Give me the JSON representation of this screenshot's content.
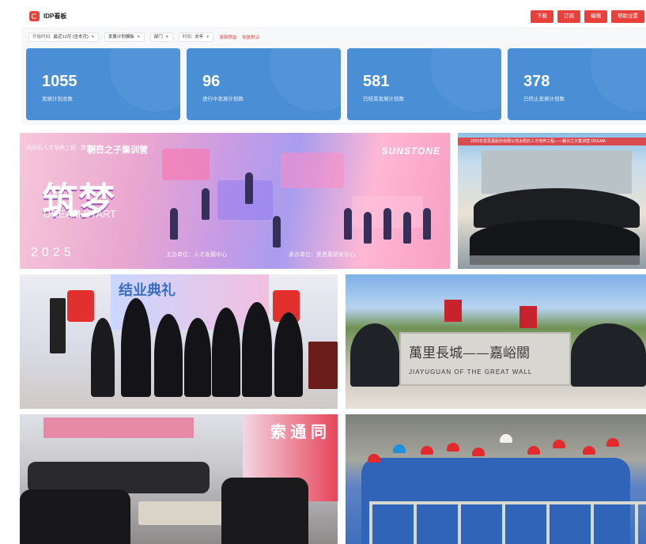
{
  "app": {
    "title": "IDP看板",
    "logo_icon": "app-logo-icon",
    "accent": "#e8403a",
    "card_color": "#4a8fd6"
  },
  "actions": [
    "下载",
    "订阅",
    "编辑",
    "帮助设置"
  ],
  "filters": [
    {
      "label": "开始时间:",
      "value": "最近12月 (含本月)"
    },
    {
      "label": "",
      "value": "发展计划模板"
    },
    {
      "label": "",
      "value": "部门"
    },
    {
      "label": "时间:",
      "value": "去年"
    }
  ],
  "filter_links": [
    "清除筛选",
    "恢复默认"
  ],
  "stats": [
    {
      "value": "1055",
      "label": "发展计划总数"
    },
    {
      "value": "96",
      "label": "进行中发展计划数"
    },
    {
      "value": "581",
      "label": "已结束发展计划数"
    },
    {
      "value": "378",
      "label": "已终止发展计划数"
    }
  ],
  "photos": {
    "banner": {
      "top_line": "光阳石人才培养工程 · 筑梦之旅",
      "brand": "朝日之子集训营",
      "logo": "SUNSTONE",
      "title": "筑梦",
      "subtitle": "DREAM START",
      "year": "2025",
      "host": "主办单位：人才发展中心",
      "organizer": "承办单位：爱思嘉研发中心"
    },
    "team1": {
      "strip": "2025年爱思嘉股份有限公司太阳石人才培养工程——朝日之子集训营 DREAM"
    },
    "award": {
      "screen_text": "结业典礼"
    },
    "wall": {
      "stone_cn": "萬里長城——嘉峪關",
      "stone_en": "JIAYUGUAN OF THE GREAT WALL"
    },
    "classroom": {
      "banner_text": "索 通 同"
    }
  }
}
